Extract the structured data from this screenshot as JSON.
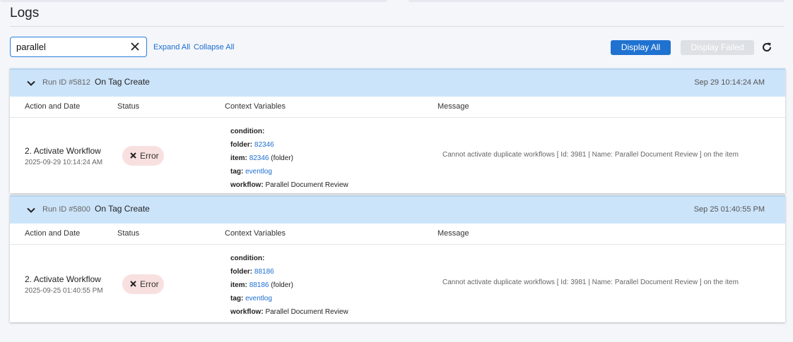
{
  "page": {
    "title": "Logs"
  },
  "search": {
    "value": "parallel"
  },
  "toolbar": {
    "expand_all": "Expand All",
    "collapse_all": "Collapse All",
    "display_all": "Display All",
    "display_failed": "Display Failed"
  },
  "columns": {
    "action": "Action and Date",
    "status": "Status",
    "context": "Context Variables",
    "message": "Message"
  },
  "runs": [
    {
      "run_id": "Run ID #5812",
      "trigger": "On Tag Create",
      "timestamp": "Sep 29 10:14:24 AM",
      "entry": {
        "action": "2. Activate Workflow",
        "date": "2025-09-29 10:14:24 AM",
        "status": "Error",
        "context": {
          "condition_key": "condition:",
          "folder_key": "folder:",
          "folder_val": "82346",
          "item_key": "item:",
          "item_val": "82346",
          "item_suffix": " (folder)",
          "tag_key": "tag:",
          "tag_val": "eventlog",
          "workflow_key": "workflow:",
          "workflow_val": "Parallel Document Review"
        },
        "message": "Cannot activate duplicate workflows [ Id: 3981 | Name: Parallel Document Review ] on the item"
      }
    },
    {
      "run_id": "Run ID #5800",
      "trigger": "On Tag Create",
      "timestamp": "Sep 25 01:40:55 PM",
      "entry": {
        "action": "2. Activate Workflow",
        "date": "2025-09-25 01:40:55 PM",
        "status": "Error",
        "context": {
          "condition_key": "condition:",
          "folder_key": "folder:",
          "folder_val": "88186",
          "item_key": "item:",
          "item_val": "88186",
          "item_suffix": " (folder)",
          "tag_key": "tag:",
          "tag_val": "eventlog",
          "workflow_key": "workflow:",
          "workflow_val": "Parallel Document Review"
        },
        "message": "Cannot activate duplicate workflows [ Id: 3981 | Name: Parallel Document Review ] on the item"
      }
    }
  ],
  "colors": {
    "accent": "#1f72d0",
    "header_bg": "#cce4fa",
    "error_badge": "#f9e0e0"
  },
  "icons": {
    "clear": "close-icon",
    "refresh": "refresh-icon",
    "collapse": "chevron-down-icon",
    "error": "x-icon"
  }
}
